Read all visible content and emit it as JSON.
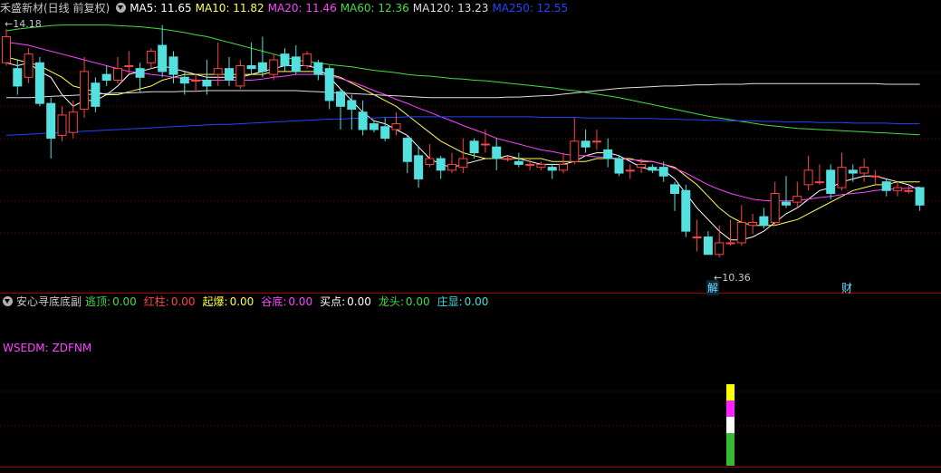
{
  "title": "禾盛新材(日线 前复权)",
  "ma_legend": [
    {
      "label": "MA5: 11.65",
      "color": "#ffffff"
    },
    {
      "label": "MA10: 11.82",
      "color": "#ffff55"
    },
    {
      "label": "MA20: 11.46",
      "color": "#ff44ff"
    },
    {
      "label": "MA60: 12.36",
      "color": "#44dd44"
    },
    {
      "label": "MA120: 13.23",
      "color": "#dddddd"
    },
    {
      "label": "MA250: 12.55",
      "color": "#2244ff"
    }
  ],
  "high_label": "14.18",
  "low_label": "←10.36",
  "event_markers": [
    "解",
    "财"
  ],
  "indicator": {
    "name": "安心寻底底副",
    "items": [
      {
        "label": "逃顶:",
        "value": "0.00",
        "color": "#44dd44"
      },
      {
        "label": "红柱:",
        "value": "0.00",
        "color": "#ff4444"
      },
      {
        "label": "起爆:",
        "value": "0.00",
        "color": "#ffff44"
      },
      {
        "label": "谷底:",
        "value": "0.00",
        "color": "#ff44ff"
      },
      {
        "label": "买点:",
        "value": "0.00",
        "color": "#ffffff"
      },
      {
        "label": "龙头:",
        "value": "0.00",
        "color": "#44dd44"
      },
      {
        "label": "庄显:",
        "value": "0.00",
        "color": "#44dddd"
      }
    ],
    "formula_label": "WSEDM: ZDFNM"
  },
  "colors": {
    "up": "#ff4444",
    "down": "#55e0e0",
    "grid": "#7a0000"
  },
  "chart_data": {
    "type": "candlestick",
    "y_range": [
      10.0,
      14.4
    ],
    "candles": [
      [
        13.6,
        14.05,
        14.18,
        13.55
      ],
      [
        13.5,
        13.2,
        13.65,
        13.05
      ],
      [
        13.35,
        13.75,
        13.85,
        13.25
      ],
      [
        13.6,
        12.9,
        13.7,
        12.85
      ],
      [
        12.9,
        12.3,
        13.0,
        11.95
      ],
      [
        12.35,
        12.7,
        12.85,
        12.25
      ],
      [
        12.4,
        12.75,
        12.95,
        12.3
      ],
      [
        12.8,
        13.45,
        13.7,
        12.65
      ],
      [
        13.25,
        12.85,
        13.35,
        12.75
      ],
      [
        13.4,
        13.3,
        13.55,
        13.2
      ],
      [
        13.3,
        13.5,
        13.7,
        13.25
      ],
      [
        13.55,
        13.55,
        13.8,
        13.4
      ],
      [
        13.5,
        13.35,
        13.6,
        13.1
      ],
      [
        13.6,
        13.8,
        13.85,
        13.5
      ],
      [
        13.9,
        13.45,
        14.25,
        13.35
      ],
      [
        13.7,
        13.4,
        13.8,
        13.25
      ],
      [
        13.35,
        13.25,
        13.45,
        13.05
      ],
      [
        13.3,
        13.3,
        13.4,
        13.1
      ],
      [
        13.3,
        13.2,
        13.65,
        13.05
      ],
      [
        13.4,
        13.5,
        13.95,
        13.2
      ],
      [
        13.5,
        13.3,
        13.7,
        13.2
      ],
      [
        13.2,
        13.55,
        13.65,
        13.15
      ],
      [
        13.55,
        13.5,
        13.95,
        13.4
      ],
      [
        13.6,
        13.45,
        14.05,
        13.35
      ],
      [
        13.4,
        13.65,
        13.75,
        13.3
      ],
      [
        13.75,
        13.55,
        13.85,
        13.45
      ],
      [
        13.7,
        13.45,
        13.9,
        13.4
      ],
      [
        13.55,
        13.75,
        13.8,
        13.5
      ],
      [
        13.6,
        13.4,
        13.65,
        13.3
      ],
      [
        13.5,
        12.95,
        13.55,
        12.8
      ],
      [
        13.1,
        12.85,
        13.15,
        12.45
      ],
      [
        12.95,
        12.8,
        13.05,
        12.45
      ],
      [
        12.75,
        12.45,
        12.95,
        12.35
      ],
      [
        12.55,
        12.45,
        12.6,
        12.4
      ],
      [
        12.5,
        12.3,
        12.65,
        12.25
      ],
      [
        12.45,
        12.55,
        12.75,
        12.35
      ],
      [
        12.3,
        11.9,
        12.35,
        11.7
      ],
      [
        12.0,
        11.6,
        12.15,
        11.45
      ],
      [
        11.85,
        11.95,
        12.2,
        11.8
      ],
      [
        11.95,
        11.75,
        12.0,
        11.6
      ],
      [
        11.75,
        11.85,
        12.05,
        11.7
      ],
      [
        11.8,
        11.95,
        12.3,
        11.7
      ],
      [
        12.25,
        12.05,
        12.3,
        11.95
      ],
      [
        12.2,
        12.2,
        12.45,
        12.05
      ],
      [
        12.15,
        11.95,
        12.3,
        11.75
      ],
      [
        11.95,
        11.95,
        12.0,
        11.9
      ],
      [
        11.9,
        11.85,
        12.05,
        11.8
      ],
      [
        11.85,
        11.85,
        11.95,
        11.75
      ],
      [
        11.8,
        11.85,
        11.9,
        11.75
      ],
      [
        11.8,
        11.75,
        11.85,
        11.6
      ],
      [
        11.75,
        11.85,
        12.05,
        11.7
      ],
      [
        11.9,
        12.25,
        12.65,
        11.85
      ],
      [
        12.25,
        12.15,
        12.45,
        12.05
      ],
      [
        12.25,
        12.25,
        12.45,
        12.1
      ],
      [
        12.1,
        11.95,
        12.3,
        11.8
      ],
      [
        11.95,
        11.7,
        12.0,
        11.65
      ],
      [
        11.75,
        11.75,
        11.85,
        11.6
      ],
      [
        11.8,
        11.85,
        11.95,
        11.7
      ],
      [
        11.8,
        11.75,
        11.85,
        11.7
      ],
      [
        11.8,
        11.65,
        11.9,
        11.55
      ],
      [
        11.5,
        11.35,
        11.55,
        11.05
      ],
      [
        11.4,
        10.7,
        11.5,
        10.6
      ],
      [
        10.6,
        10.6,
        10.9,
        10.35
      ],
      [
        10.6,
        10.3,
        10.7,
        10.3
      ],
      [
        10.3,
        10.5,
        10.8,
        10.25
      ],
      [
        10.5,
        10.5,
        10.9,
        10.45
      ],
      [
        10.5,
        10.85,
        11.15,
        10.45
      ],
      [
        10.8,
        10.85,
        11.0,
        10.65
      ],
      [
        10.95,
        10.8,
        11.1,
        10.75
      ],
      [
        10.85,
        11.35,
        11.55,
        10.8
      ],
      [
        11.2,
        11.15,
        11.65,
        11.1
      ],
      [
        11.2,
        11.3,
        11.55,
        11.1
      ],
      [
        11.5,
        11.75,
        12.0,
        11.4
      ],
      [
        11.55,
        11.55,
        11.85,
        11.5
      ],
      [
        11.75,
        11.35,
        11.85,
        11.25
      ],
      [
        11.45,
        11.8,
        12.05,
        11.4
      ],
      [
        11.75,
        11.7,
        11.85,
        11.55
      ],
      [
        11.7,
        11.8,
        11.95,
        11.55
      ],
      [
        11.65,
        11.65,
        11.75,
        11.5
      ],
      [
        11.55,
        11.4,
        11.6,
        11.3
      ],
      [
        11.4,
        11.45,
        11.55,
        11.3
      ],
      [
        11.4,
        11.4,
        11.5,
        11.35
      ],
      [
        11.45,
        11.15,
        11.45,
        11.05
      ]
    ],
    "ma_lines": [
      {
        "name": "MA5",
        "color": "#ffffff",
        "values": [
          13.6,
          13.55,
          13.6,
          13.45,
          13.35,
          13.05,
          12.85,
          12.95,
          12.95,
          13.05,
          13.2,
          13.4,
          13.45,
          13.5,
          13.55,
          13.5,
          13.45,
          13.4,
          13.35,
          13.35,
          13.35,
          13.35,
          13.4,
          13.45,
          13.5,
          13.55,
          13.55,
          13.55,
          13.5,
          13.35,
          13.15,
          12.95,
          12.75,
          12.6,
          12.55,
          12.45,
          12.35,
          12.15,
          11.95,
          11.85,
          11.8,
          11.85,
          11.9,
          11.95,
          11.95,
          12.0,
          11.95,
          11.9,
          11.85,
          11.85,
          11.85,
          11.9,
          12.0,
          12.05,
          12.05,
          12.0,
          11.9,
          11.8,
          11.75,
          11.75,
          11.6,
          11.35,
          11.1,
          10.9,
          10.7,
          10.55,
          10.55,
          10.6,
          10.7,
          10.85,
          11.0,
          11.1,
          11.25,
          11.4,
          11.45,
          11.55,
          11.6,
          11.65,
          11.65,
          11.6,
          11.55,
          11.5,
          11.4
        ]
      },
      {
        "name": "MA10",
        "color": "#ffff55",
        "values": [
          13.7,
          13.65,
          13.6,
          13.55,
          13.45,
          13.35,
          13.2,
          13.15,
          13.1,
          13.05,
          13.05,
          13.1,
          13.15,
          13.2,
          13.3,
          13.35,
          13.4,
          13.4,
          13.4,
          13.4,
          13.4,
          13.4,
          13.4,
          13.4,
          13.45,
          13.45,
          13.45,
          13.45,
          13.45,
          13.4,
          13.35,
          13.25,
          13.15,
          13.05,
          12.95,
          12.85,
          12.7,
          12.55,
          12.4,
          12.25,
          12.15,
          12.05,
          12.0,
          11.95,
          11.95,
          11.95,
          11.95,
          11.95,
          11.95,
          11.9,
          11.9,
          11.9,
          11.9,
          11.95,
          11.95,
          11.95,
          11.95,
          11.9,
          11.9,
          11.85,
          11.8,
          11.65,
          11.5,
          11.3,
          11.1,
          10.95,
          10.85,
          10.8,
          10.8,
          10.8,
          10.85,
          10.9,
          11.0,
          11.1,
          11.2,
          11.3,
          11.4,
          11.45,
          11.5,
          11.5,
          11.55,
          11.55,
          11.55
        ]
      },
      {
        "name": "MA20",
        "color": "#ff44ff",
        "values": [
          13.95,
          13.93,
          13.9,
          13.85,
          13.8,
          13.75,
          13.7,
          13.65,
          13.6,
          13.55,
          13.5,
          13.45,
          13.43,
          13.4,
          13.38,
          13.35,
          13.33,
          13.3,
          13.3,
          13.3,
          13.3,
          13.3,
          13.3,
          13.32,
          13.35,
          13.37,
          13.4,
          13.4,
          13.4,
          13.38,
          13.33,
          13.27,
          13.2,
          13.12,
          13.05,
          12.97,
          12.9,
          12.82,
          12.75,
          12.67,
          12.6,
          12.52,
          12.45,
          12.38,
          12.3,
          12.25,
          12.2,
          12.15,
          12.1,
          12.07,
          12.03,
          12.0,
          12.0,
          11.98,
          11.97,
          11.95,
          11.93,
          11.92,
          11.9,
          11.85,
          11.78,
          11.7,
          11.6,
          11.5,
          11.42,
          11.35,
          11.3,
          11.25,
          11.23,
          11.22,
          11.22,
          11.23,
          11.25,
          11.28,
          11.3,
          11.33,
          11.35,
          11.37,
          11.4,
          11.42,
          11.43,
          11.44,
          11.46
        ]
      },
      {
        "name": "MA60",
        "color": "#44dd44",
        "values": [
          14.15,
          14.18,
          14.2,
          14.22,
          14.24,
          14.25,
          14.25,
          14.25,
          14.25,
          14.25,
          14.24,
          14.23,
          14.22,
          14.2,
          14.18,
          14.15,
          14.12,
          14.08,
          14.05,
          14.0,
          13.95,
          13.9,
          13.85,
          13.8,
          13.75,
          13.7,
          13.65,
          13.62,
          13.6,
          13.57,
          13.55,
          13.53,
          13.5,
          13.47,
          13.45,
          13.43,
          13.4,
          13.38,
          13.37,
          13.35,
          13.33,
          13.32,
          13.3,
          13.29,
          13.27,
          13.25,
          13.23,
          13.21,
          13.19,
          13.17,
          13.14,
          13.12,
          13.09,
          13.06,
          13.03,
          13.0,
          12.96,
          12.92,
          12.88,
          12.84,
          12.8,
          12.76,
          12.72,
          12.68,
          12.65,
          12.62,
          12.59,
          12.56,
          12.53,
          12.51,
          12.49,
          12.47,
          12.46,
          12.45,
          12.44,
          12.43,
          12.42,
          12.41,
          12.4,
          12.39,
          12.38,
          12.37,
          12.36
        ]
      },
      {
        "name": "MA120",
        "color": "#dddddd",
        "values": [
          13.0,
          13.0,
          13.0,
          13.01,
          13.02,
          13.03,
          13.04,
          13.05,
          13.06,
          13.07,
          13.08,
          13.08,
          13.09,
          13.1,
          13.1,
          13.1,
          13.11,
          13.11,
          13.12,
          13.12,
          13.12,
          13.12,
          13.12,
          13.12,
          13.12,
          13.12,
          13.12,
          13.11,
          13.1,
          13.09,
          13.08,
          13.07,
          13.06,
          13.05,
          13.04,
          13.03,
          13.02,
          13.01,
          13.0,
          13.0,
          13.0,
          13.0,
          13.0,
          13.0,
          13.0,
          13.01,
          13.01,
          13.02,
          13.03,
          13.04,
          13.06,
          13.08,
          13.1,
          13.12,
          13.14,
          13.16,
          13.17,
          13.18,
          13.19,
          13.2,
          13.2,
          13.21,
          13.22,
          13.22,
          13.23,
          13.23,
          13.23,
          13.24,
          13.24,
          13.24,
          13.24,
          13.24,
          13.24,
          13.24,
          13.24,
          13.24,
          13.24,
          13.24,
          13.24,
          13.23,
          13.23,
          13.23,
          13.23
        ]
      },
      {
        "name": "MA250",
        "color": "#2244ff",
        "values": [
          12.35,
          12.36,
          12.37,
          12.38,
          12.39,
          12.4,
          12.41,
          12.42,
          12.43,
          12.44,
          12.45,
          12.46,
          12.47,
          12.48,
          12.49,
          12.5,
          12.51,
          12.52,
          12.53,
          12.54,
          12.54,
          12.55,
          12.56,
          12.57,
          12.58,
          12.59,
          12.6,
          12.61,
          12.62,
          12.63,
          12.63,
          12.64,
          12.65,
          12.65,
          12.66,
          12.66,
          12.67,
          12.67,
          12.67,
          12.67,
          12.67,
          12.67,
          12.67,
          12.67,
          12.67,
          12.67,
          12.67,
          12.67,
          12.66,
          12.66,
          12.66,
          12.66,
          12.65,
          12.65,
          12.65,
          12.65,
          12.64,
          12.64,
          12.64,
          12.63,
          12.63,
          12.62,
          12.62,
          12.61,
          12.61,
          12.6,
          12.6,
          12.6,
          12.59,
          12.59,
          12.58,
          12.58,
          12.58,
          12.57,
          12.57,
          12.57,
          12.56,
          12.56,
          12.56,
          12.56,
          12.55,
          12.55,
          12.55
        ]
      }
    ],
    "signal_bar": {
      "index": 65,
      "segments": [
        {
          "color": "#ffff00",
          "value": 1
        },
        {
          "color": "#ff22ff",
          "value": 1
        },
        {
          "color": "#ffffff",
          "value": 1
        },
        {
          "color": "#33bb33",
          "value": 2
        }
      ]
    }
  }
}
